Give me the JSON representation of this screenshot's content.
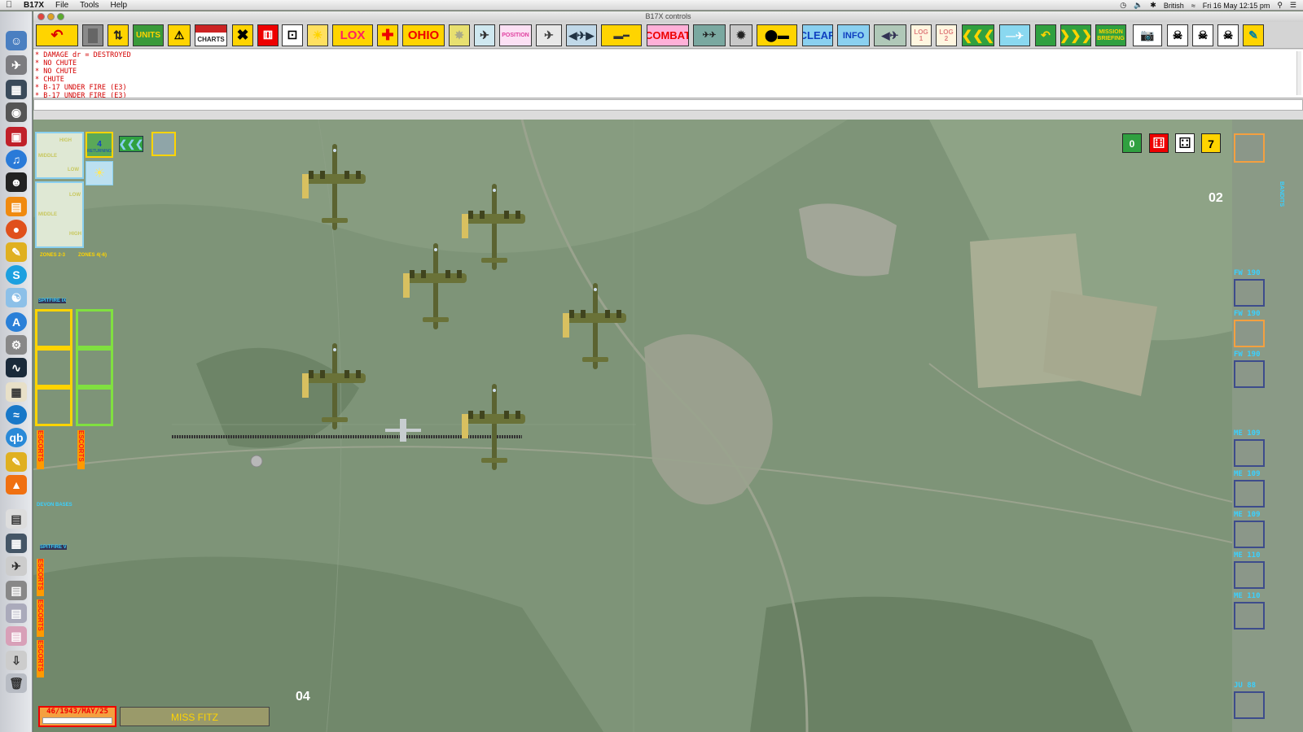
{
  "menubar": {
    "app_name": "B17X",
    "items": [
      "File",
      "Tools",
      "Help"
    ],
    "status_right": {
      "locale": "British",
      "datetime": "Fri 16 May  12:15 pm"
    }
  },
  "window": {
    "title": "B17X controls"
  },
  "toolbar": {
    "units": "UNITS",
    "charts": "CHARTS",
    "lox": "LOX",
    "ohio": "OHIO",
    "position": "POSITION",
    "combat": "COMBAT",
    "clear": "CLEAR",
    "info": "INFO",
    "log1": "LOG\n1",
    "log2": "LOG\n2",
    "mission_briefing": "MISSION\nBRIEFING"
  },
  "log": {
    "lines": [
      "* DAMAGE dr = DESTROYED",
      "* NO CHUTE",
      "* NO CHUTE",
      "* CHUTE",
      "* B-17 UNDER FIRE (E3)",
      "* B-17 UNDER FIRE (E3)"
    ]
  },
  "map": {
    "zone_top_right": "02",
    "zone_bottom_left": "04",
    "date": "46/1943/MAY/25",
    "bomber_name": "MISS FITZ",
    "formation": {
      "high": "HIGH",
      "middle": "MIDDLE",
      "low": "LOW",
      "returning_count": "4",
      "returning_label": "RETURNING"
    },
    "zones_a": "ZONES 2-3",
    "zones_b": "ZONES 4(-6)",
    "spitfire_ix": "SPITFIRE IX",
    "spitfire_v": "SPITFIRE V",
    "devon_bases": "DEVON BASES",
    "escorts": "ESCORTS",
    "counters": {
      "zero": "0",
      "seven": "7"
    }
  },
  "bandits": {
    "label": "BANDITS",
    "slots": [
      "FW 190",
      "FW 190",
      "FW 190",
      "ME 109",
      "ME 109",
      "ME 109",
      "ME 110",
      "ME 110",
      "JU 88"
    ]
  },
  "colors": {
    "log_text": "#d40000",
    "bandit_label": "#3ad0ff",
    "escort_text": "#ff1a1a",
    "toolbar_yellow": "#ffd400"
  }
}
